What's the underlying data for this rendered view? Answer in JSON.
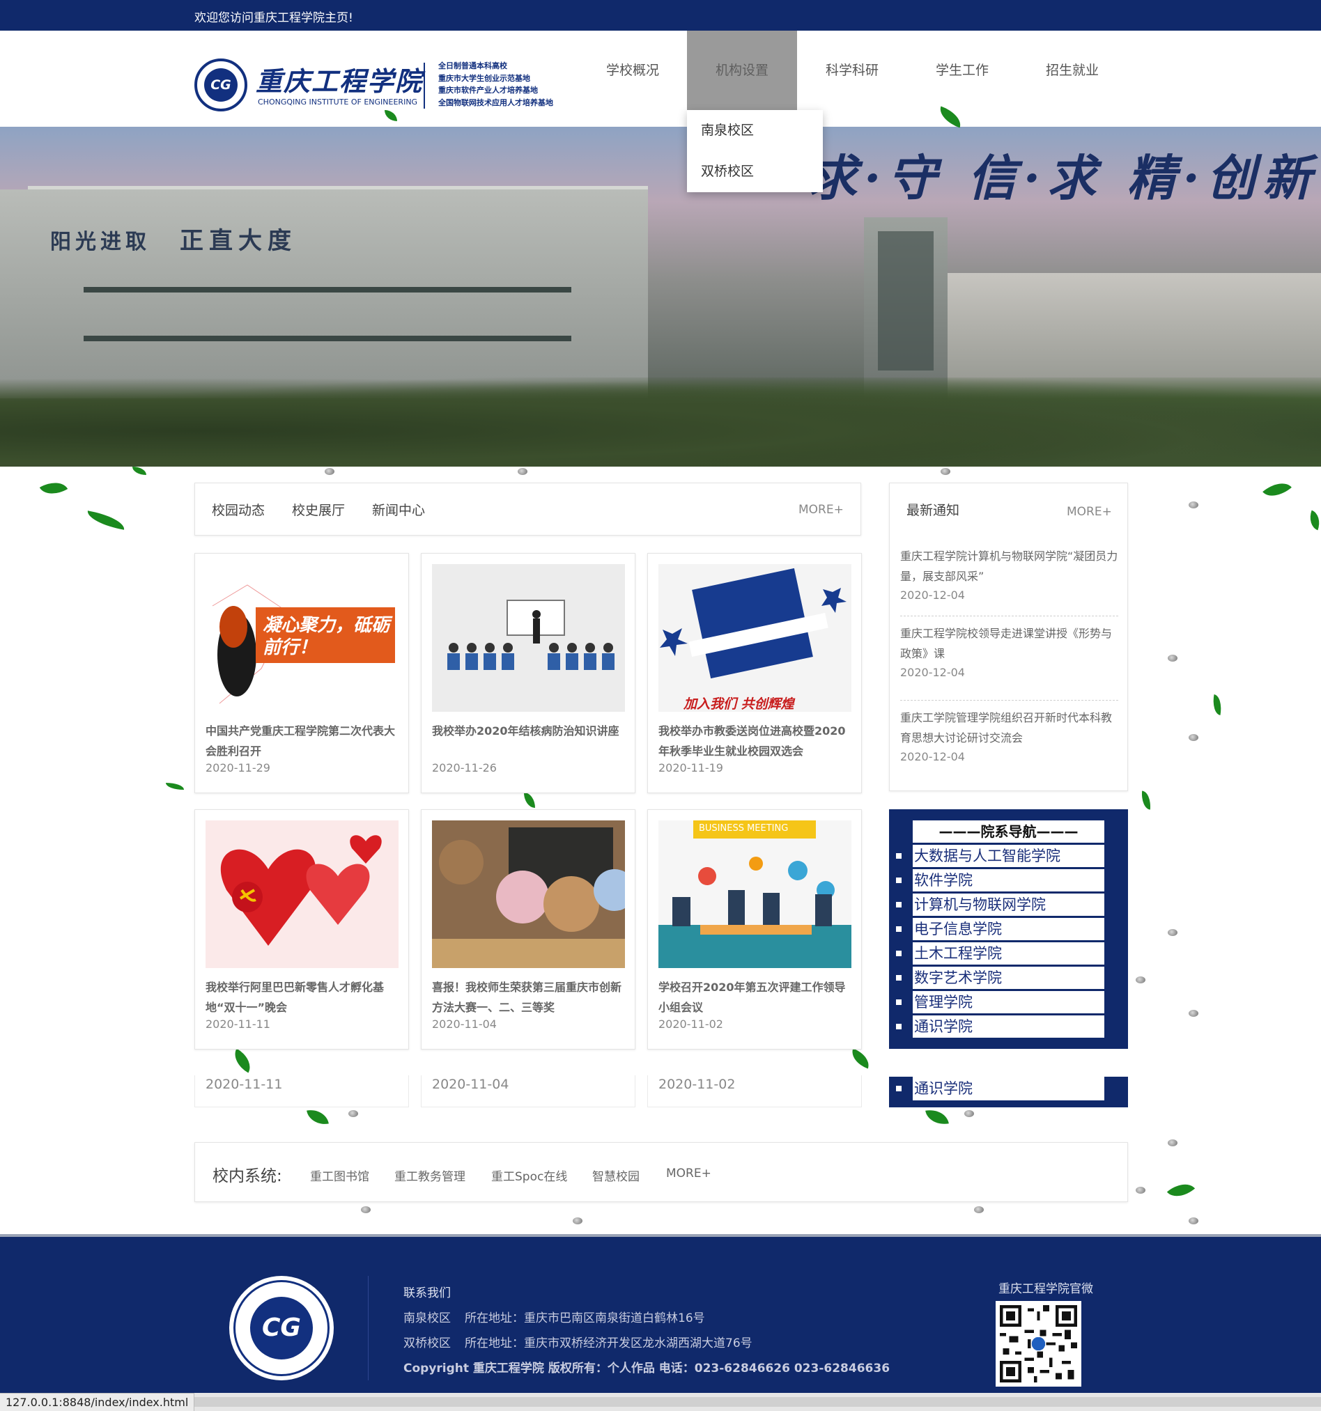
{
  "topbar": {
    "welcome": "欢迎您访问重庆工程学院主页!"
  },
  "logo": {
    "cn_name": "重庆工程学院",
    "en_name": "CHONGQING INSTITUTE OF ENGINEERING",
    "tags": [
      "全日制普通本科高校",
      "重庆市大学生创业示范基地",
      "重庆市软件产业人才培养基地",
      "全国物联网技术应用人才培养基地"
    ]
  },
  "nav": {
    "items": [
      {
        "label": "学校概况"
      },
      {
        "label": "机构设置"
      },
      {
        "label": "科学科研"
      },
      {
        "label": "学生工作"
      },
      {
        "label": "招生就业"
      }
    ],
    "active_index": 1,
    "dropdown": [
      "南泉校区",
      "双桥校区"
    ]
  },
  "banner": {
    "motto": "求·守 信·求 精·创新",
    "sign1": "阳光进取",
    "sign2": "正直大度"
  },
  "news": {
    "tabs": [
      "校园动态",
      "校史展厅",
      "新闻中心"
    ],
    "more": "MORE+",
    "cards": [
      {
        "title": "中国共产党重庆工程学院第二次代表大会胜利召开",
        "date": "2020-11-29",
        "image": "rally-banner",
        "caption": "凝心聚力，砥砺前行！"
      },
      {
        "title": "我校举办2020年结核病防治知识讲座",
        "date": "2020-11-26",
        "image": "lecture-illustration"
      },
      {
        "title": "我校举办市教委送岗位进高校暨2020年秋季毕业生就业校园双选会",
        "date": "2020-11-19",
        "image": "job-poster",
        "caption": "加入我们 共创辉煌"
      },
      {
        "title": "我校举行阿里巴巴新零售人才孵化基地“双十一”晚会",
        "date": "2020-11-11",
        "image": "hearts-party"
      },
      {
        "title": "喜报！我校师生荣获第三届重庆市创新方法大赛一、二、三等奖",
        "date": "2020-11-04",
        "image": "bears-classroom"
      },
      {
        "title": "学校召开2020年第五次评建工作领导小组会议",
        "date": "2020-11-02",
        "image": "business-meeting",
        "caption": "BUSINESS MEETING"
      }
    ],
    "ghost_dates": [
      "2020-11-11",
      "2020-11-04",
      "2020-11-02"
    ]
  },
  "notices": {
    "title": "最新通知",
    "more": "MORE+",
    "items": [
      {
        "title": "重庆工程学院计算机与物联网学院“凝团员力量，展支部风采”",
        "date": "2020-12-04"
      },
      {
        "title": "重庆工程学院校领导走进课堂讲授《形势与政策》课",
        "date": "2020-12-04"
      },
      {
        "title": "重庆工学院管理学院组织召开新时代本科教育思想大讨论研讨交流会",
        "date": "2020-12-04"
      }
    ]
  },
  "departments": {
    "title": "———院系导航———",
    "items": [
      "大数据与人工智能学院",
      "软件学院",
      "计算机与物联网学院",
      "电子信息学院",
      "土木工程学院",
      "数字艺术学院",
      "管理学院",
      "通识学院"
    ],
    "ghost_item": "通识学院"
  },
  "systems": {
    "label": "校内系统:",
    "links": [
      "重工图书馆",
      "重工教务管理",
      "重工Spoc在线",
      "智慧校园",
      "MORE+"
    ]
  },
  "footer": {
    "contact_title": "联系我们",
    "campus1_name": "南泉校区",
    "campus1_addr": "所在地址：重庆市巴南区南泉街道白鹤林16号",
    "campus2_name": "双桥校区",
    "campus2_addr": "所在地址：重庆市双桥经济开发区龙水湖西湖大道76号",
    "copyright": "Copyright   重庆工程学院 版权所有：个人作品     电话：023-62846626 023-62846636",
    "qr_label": "重庆工程学院官微",
    "emblem_text": "CG"
  },
  "statusbar": {
    "url": "127.0.0.1:8848/index/index.html"
  }
}
